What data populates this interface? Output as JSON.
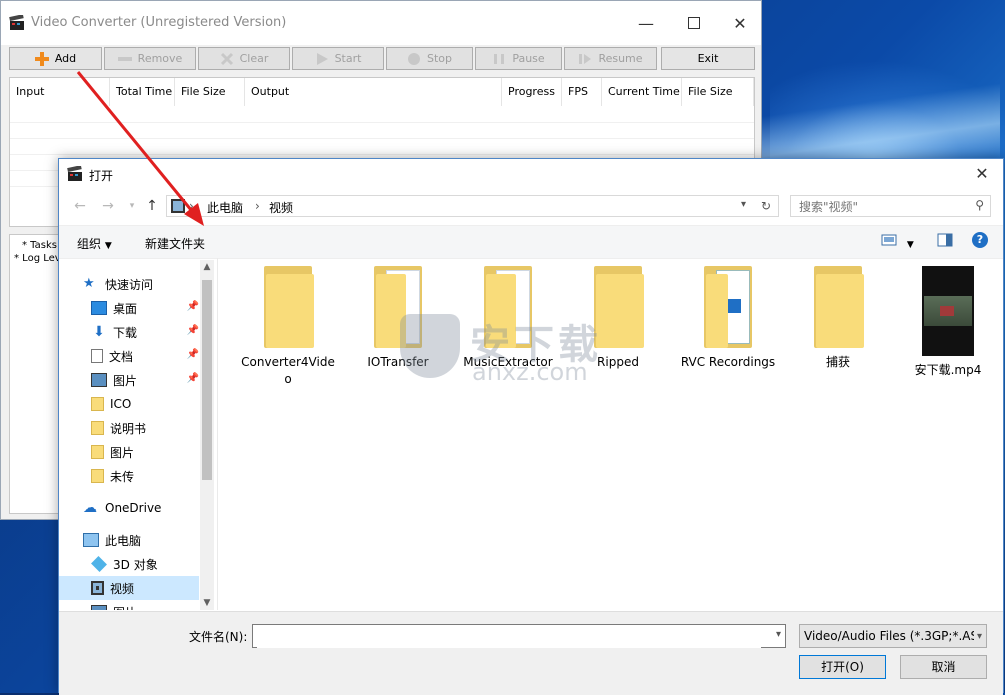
{
  "app": {
    "title": "Video Converter  (Unregistered Version)",
    "toolbar": {
      "add": "Add",
      "remove": "Remove",
      "clear": "Clear",
      "start": "Start",
      "stop": "Stop",
      "pause": "Pause",
      "resume": "Resume",
      "exit": "Exit"
    },
    "columns": [
      "Input",
      "Total Time",
      "File Size",
      "Output",
      "Progress",
      "FPS",
      "Current Time",
      "File Size"
    ],
    "log_lines": [
      "* Tasks",
      "* Log Lev"
    ]
  },
  "dialog": {
    "title": "打开",
    "breadcrumb": [
      "此电脑",
      "视频"
    ],
    "search_placeholder": "搜索\"视频\"",
    "commands": {
      "organize": "组织",
      "new_folder": "新建文件夹"
    },
    "nav": {
      "quick_access": "快速访问",
      "quick_items": [
        "桌面",
        "下载",
        "文档",
        "图片",
        "ICO",
        "说明书",
        "图片",
        "未传"
      ],
      "onedrive": "OneDrive",
      "this_pc": "此电脑",
      "pc_items": [
        "3D 对象",
        "视频",
        "图片"
      ]
    },
    "files": [
      {
        "name": "Converter4Video",
        "kind": "folder"
      },
      {
        "name": "IOTransfer",
        "kind": "folder-docs"
      },
      {
        "name": "MusicExtractor",
        "kind": "folder-docs"
      },
      {
        "name": "Ripped",
        "kind": "folder"
      },
      {
        "name": "RVC Recordings",
        "kind": "folder-docs"
      },
      {
        "name": "捕获",
        "kind": "folder"
      },
      {
        "name": "安下载.mp4",
        "kind": "video"
      }
    ],
    "filename_label": "文件名(N):",
    "filename_value": "",
    "filetype": "Video/Audio Files (*.3GP;*.AS",
    "open_button": "打开(O)",
    "cancel_button": "取消"
  },
  "watermark": {
    "cn": "安下载",
    "en": "anxz.com"
  },
  "colors": {
    "accent": "#0078d7",
    "arrow": "#e02020",
    "folder": "#f9dc7a"
  }
}
